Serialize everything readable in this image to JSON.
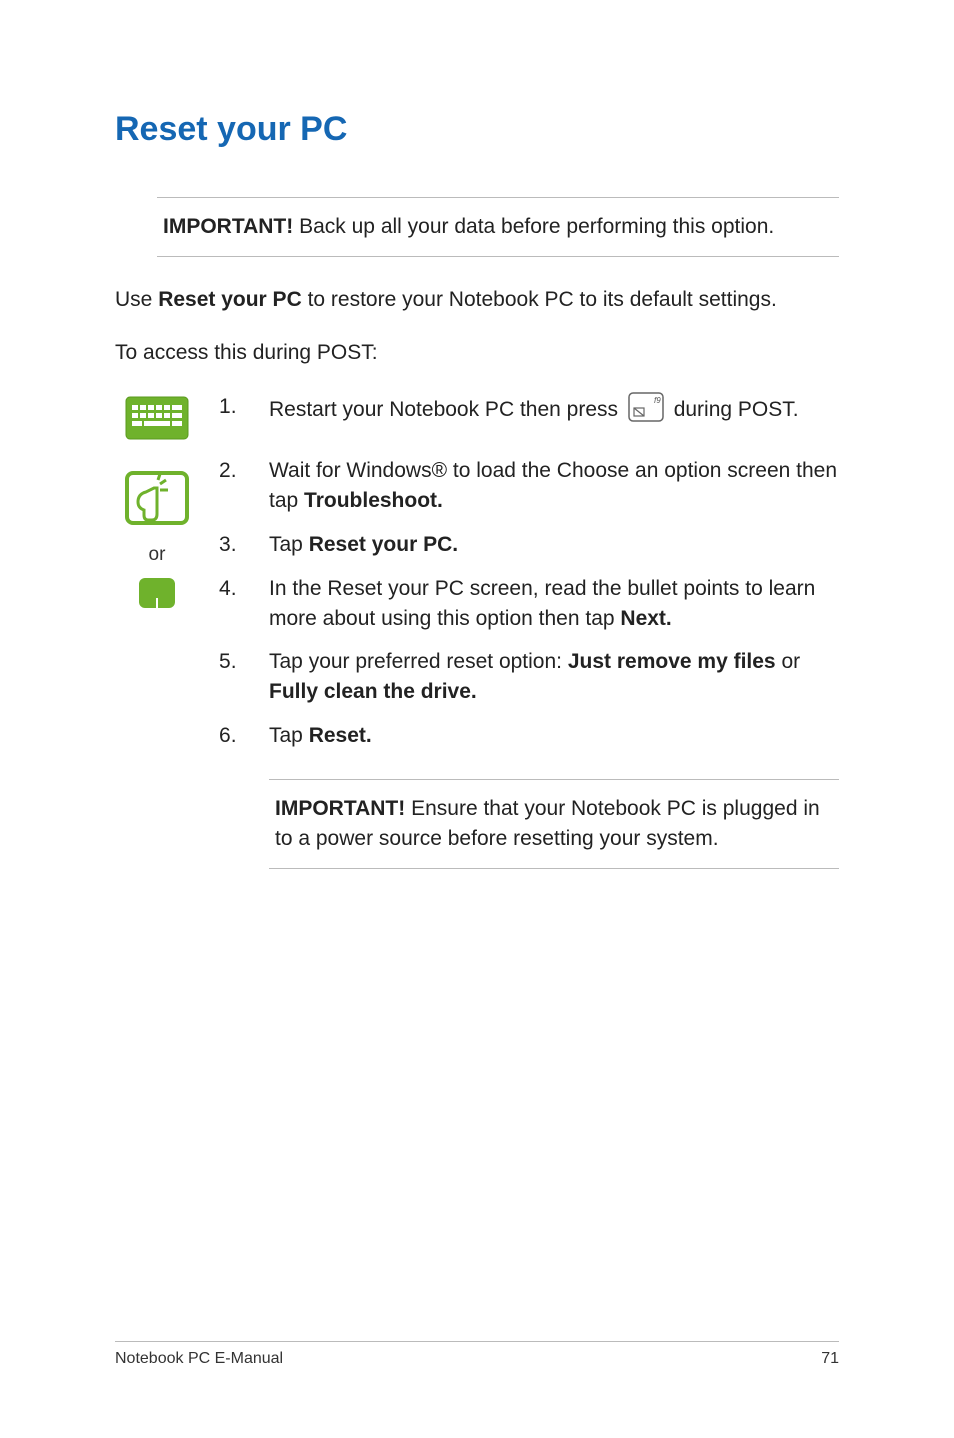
{
  "heading": "Reset your PC",
  "note1": {
    "label": "IMPORTANT!",
    "text": " Back up all your data before performing this option."
  },
  "intro": {
    "pre": "Use ",
    "bold": "Reset your PC",
    "post": " to restore your Notebook PC to its default settings."
  },
  "intro2": "To access this during POST:",
  "or_text": "or",
  "steps": {
    "s1": {
      "pre": "Restart your Notebook PC then press ",
      "post": " during POST."
    },
    "s2": {
      "pre": "Wait for Windows® to load the Choose an option screen then tap ",
      "bold": "Troubleshoot."
    },
    "s3": {
      "pre": "Tap ",
      "bold": "Reset your PC."
    },
    "s4": {
      "pre": "In the Reset your PC screen, read the bullet points to learn more about using this option then tap ",
      "bold": "Next."
    },
    "s5": {
      "pre": "Tap your preferred reset option: ",
      "bold1": "Just remove my files",
      "mid": " or ",
      "bold2": "Fully clean the drive."
    },
    "s6": {
      "pre": "Tap ",
      "bold": "Reset."
    }
  },
  "note2": {
    "label": "IMPORTANT!",
    "text": " Ensure that your Notebook PC is plugged in to a power source before resetting your system."
  },
  "footer": {
    "left": "Notebook PC E-Manual",
    "right": "71"
  },
  "icons": {
    "keyboard": "keyboard-icon",
    "touch": "touch-icon",
    "touchpad": "touchpad-icon",
    "f9key": "f9-key-icon"
  }
}
